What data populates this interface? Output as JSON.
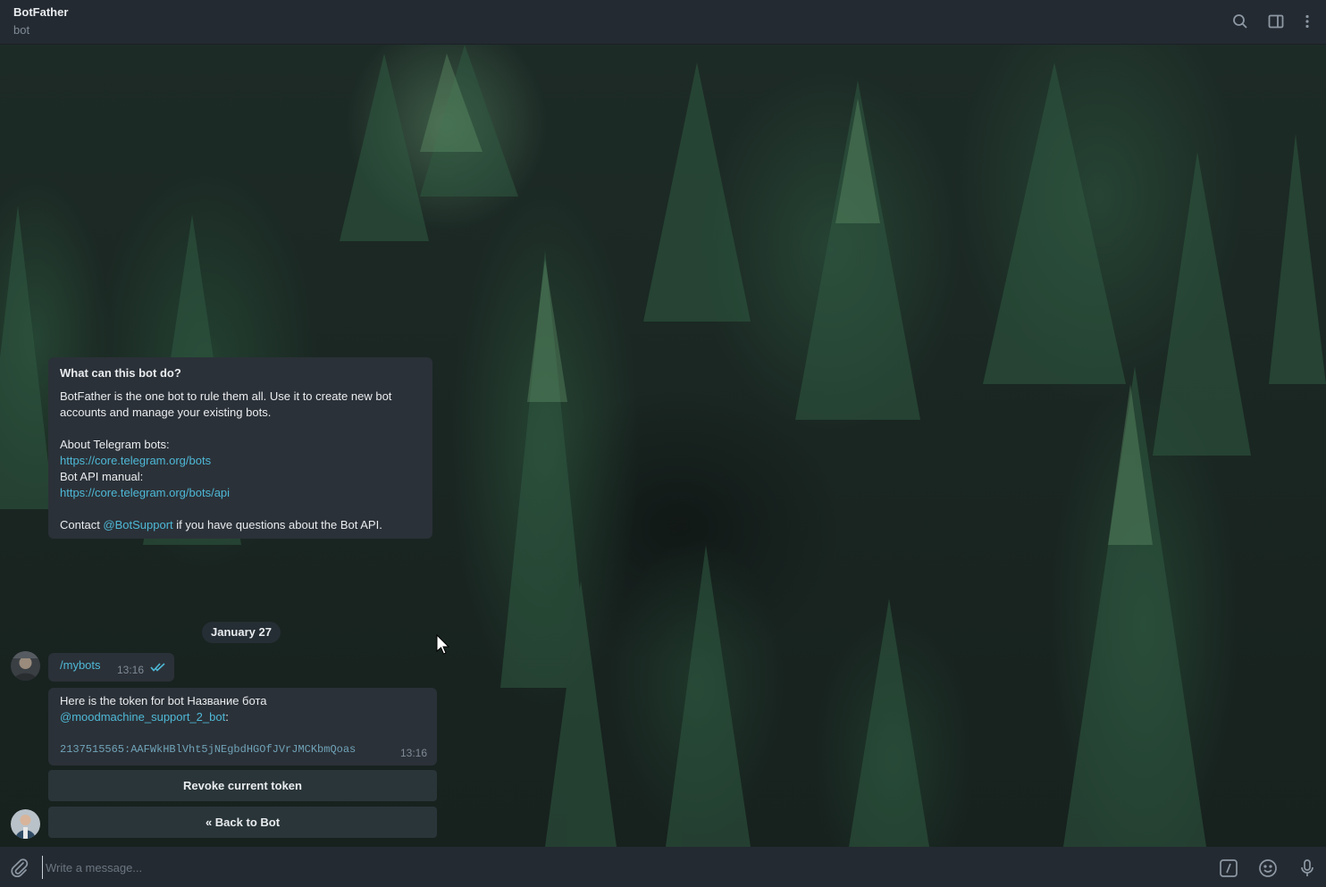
{
  "header": {
    "title": "BotFather",
    "subtitle": "bot",
    "icons": [
      "search-icon",
      "sidebar-toggle-icon",
      "more-vert-icon"
    ]
  },
  "info_message": {
    "title": "What can this bot do?",
    "description": "BotFather is the one bot to rule them all. Use it to create new bot accounts and manage your existing bots.",
    "about_label": "About Telegram bots:",
    "about_link": "https://core.telegram.org/bots",
    "api_label": "Bot API manual:",
    "api_link": "https://core.telegram.org/bots/api",
    "contact_prefix": "Contact ",
    "contact_mention": "@BotSupport",
    "contact_suffix": " if you have questions about the Bot API."
  },
  "date_separator": "January 27",
  "outgoing_message": {
    "text": "/mybots",
    "time": "13:16",
    "status": "read"
  },
  "token_message": {
    "line1": "Here is the token for bot Название бота",
    "mention": "@moodmachine_support_2_bot",
    "mention_suffix": ":",
    "token": "2137515565:AAFWkHBlVht5jNEgbdHGOfJVrJMCKbmQoas",
    "time": "13:16"
  },
  "keyboard": {
    "revoke_label": "Revoke current token",
    "back_label": "« Back to Bot"
  },
  "composer": {
    "placeholder": "Write a message...",
    "icons": [
      "attach-icon",
      "bot-commands-icon",
      "emoji-icon",
      "microphone-icon"
    ]
  },
  "colors": {
    "link": "#4eb8d6",
    "bubble": "#2b3138",
    "header": "#242a31"
  }
}
